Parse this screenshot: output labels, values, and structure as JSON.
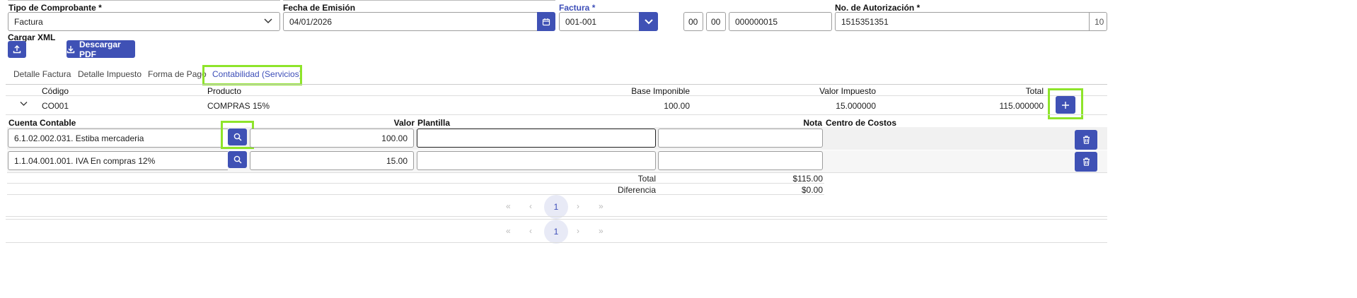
{
  "header": {
    "tipo_label": "Tipo de Comprobante",
    "tipo_value": "Factura",
    "fecha_label": "Fecha de Emisión",
    "fecha_value": "04/01/2026",
    "factura_label": "Factura",
    "factura_value": "001-001",
    "serie1": "00",
    "serie2": "00",
    "secuencial": "000000015",
    "autorizacion_label": "No. de Autorización",
    "autorizacion_value": "1515351351",
    "autorizacion_suffix": "10",
    "required_mark": "*"
  },
  "actions": {
    "cargar_xml_label": "Cargar XML",
    "descargar_pdf_label": "Descargar PDF"
  },
  "tabs": [
    {
      "label": "Detalle Factura"
    },
    {
      "label": "Detalle Impuesto"
    },
    {
      "label": "Forma de Pago"
    },
    {
      "label": "Contabilidad (Servicios)"
    }
  ],
  "table": {
    "headers": {
      "codigo": "Código",
      "producto": "Producto",
      "base": "Base Imponible",
      "valor_impuesto": "Valor Impuesto",
      "total": "Total"
    },
    "row": {
      "codigo": "CO001",
      "producto": "COMPRAS 15%",
      "base": "100.00",
      "valor_impuesto": "15.000000",
      "total": "115.000000"
    }
  },
  "sub": {
    "headers": {
      "cuenta": "Cuenta Contable",
      "valor": "Valor",
      "plantilla": "Plantilla",
      "nota": "Nota",
      "centro": "Centro de Costos"
    },
    "rows": [
      {
        "cuenta": "6.1.02.002.031. Estiba mercaderia",
        "valor": "100.00"
      },
      {
        "cuenta": "1.1.04.001.001. IVA En compras 12%",
        "valor": "15.00"
      }
    ],
    "total_label": "Total",
    "total_value": "$115.00",
    "diferencia_label": "Diferencia",
    "diferencia_value": "$0.00"
  },
  "pagination": {
    "inner_page": "1",
    "outer_page": "1"
  },
  "colors": {
    "primary": "#3f51b5",
    "highlight": "#8ee42a",
    "active_tab": "#3d4eb8"
  }
}
